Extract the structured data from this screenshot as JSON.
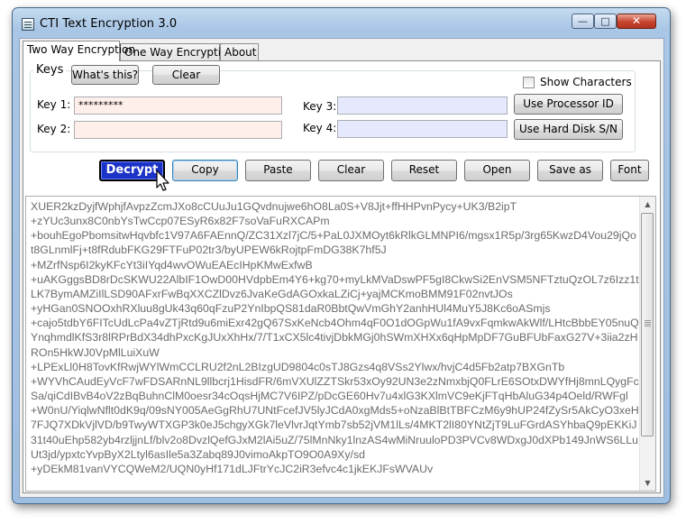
{
  "window": {
    "title": "CTI Text Encryption 3.0",
    "controls": {
      "minimize": "—",
      "maximize": "□",
      "close": "✕"
    }
  },
  "tabs": [
    {
      "label": "Two Way Encryption",
      "active": true
    },
    {
      "label": "One Way Encryption",
      "active": false
    },
    {
      "label": "About",
      "active": false
    }
  ],
  "keys": {
    "group_title": "Keys",
    "whats_this": "What's this?",
    "clear": "Clear",
    "show_characters": "Show Characters",
    "show_characters_checked": false,
    "key1_label": "Key 1:",
    "key1_value": "*********",
    "key2_label": "Key 2:",
    "key2_value": "",
    "key3_label": "Key 3:",
    "key3_value": "",
    "key4_label": "Key 4:",
    "key4_value": "",
    "use_processor_id": "Use Processor ID",
    "use_hard_disk": "Use Hard Disk S/N"
  },
  "toolbar": {
    "decrypt": "Decrypt",
    "copy": "Copy",
    "paste": "Paste",
    "clear": "Clear",
    "reset": "Reset",
    "open": "Open",
    "save_as": "Save as",
    "font": "Font"
  },
  "content": {
    "text": "XUER2kzDyjfWphjfAvpzZcmJXo8cCUuJu1GQvdnujwe6hO8La0S+V8Jjt+ffHHPvnPycy+UK3/B2ipT\n+zYUc3unx8C0nbYsTwCcp07ESyR6x82F7soVaFuRXCAPm\n+bouhEgoPbomsitwHqvbfc1V97A6FAEnnQ/ZC31Xzl7jC/5+PaL0JXMOyt6kRlkGLMNPI6/mgsx1R5p/3rg65KwzD4Vou29jQot8GLnmlFj+t8fRdubFKG29FTFuP02tr3/byUPEW6kRojtpFmDG38K7hf5J\n+MZrfNsp6I2kyKFcYt3iIYqd4wvOWuEAEcIHpKMwExfwB\n+uAKGggsBD8rDcSKWU22AlbIF1OwD00HVdpbEm4Y6+kg70+myLkMVaDswPF5gI8CkwSi2EnVSM5NFTztuQzOL7z6Izz1tLK7BymAMZiIlLSD90AFxrFwBqXXCZlDvz6JvaKeGdAGOxkaLZiCj+yajMCKmoBMM91F02nvtJOs\n+yHGan0SNOOxhRXluu8gUk43q60qFzuP2YnIbpQS81daR0BbtQwVmGhY2anhHUl4MuY5J8Kc6oASmjs\n+cajo5tdbY6FITcUdLcPa4vZTjRtd9u6miExr42gQ67SxKeNcb4Ohm4qF0O1dOGpWu1fA9vxFqmkwAkWlf/LHtcBbbEY05nuQYnqhmdlKfS3r8lRPrBdX34dhPxcKgJUxXhHx/7/T1xCX5lc4tivjDbkMGj0hSWmXHXx6qHpMpDF7GuBFUbFaxG27V+3iia2zHROn5HkWJ0VpMlLuiXuW\n+LPExLl0H8TovKfRwjWYlWmCCLRU2f2nL2BIzgUD9804c0sTJ8Gzs4q8VSs2Ylwx/hvjC4d5Fb2atp7BXGnTb\n+WYVhCAudEyVcF7wFDSARnNL9llbcrj1HisdFR/6mVXUlZZTSkr53xOy92UN3e2zNmxbjQ0FLrE6SOtxDWYfHj8mnLQygFcSa/qiCdIBvB4oV2zBqBuhnClM0oesr34cOqsHjMC7V6IPZ/pDcGE60Hv7u4xlG3KXlmVC9eKjFTqHbAluG34p4Oeld/RWFgl\n+W0nU/YiqlwNflt0dK9q/09sNY005AeGgRhU7UNtFcefJV5lyJCdA0xgMds5+oNzaBlBtTBFCzM6y9hUP24fZySr5AkCyO3xeH7FJQ7XDkVjlVD/b9TwyWTXGP3k0eJ5chgyXGk7leVlvrJqtYmb7sb52jVM1lLs/4MKT2lI80YNtZjT9LuFGrdASYhbaQ9pEKKiJ31t40uEhp582yb4rzljjnLf/blv2o8DvzlQefGJxM2lAi5uZ/75lMnNky1lnzAS4wMiNruuloPD3PVCv8WDxgJ0dXPb149JnWS6LLuUt3jd/ypxtcYvpByX2Ltyl6asIle5a3Zabq89J0vimoAkpTO9O0A9Xy/sd\n+yDEkM81vanVYCQWeM2/UQN0yHf171dLJFtrYcJC2iR3efvc4c1jkEKJFsWVAUv"
  }
}
